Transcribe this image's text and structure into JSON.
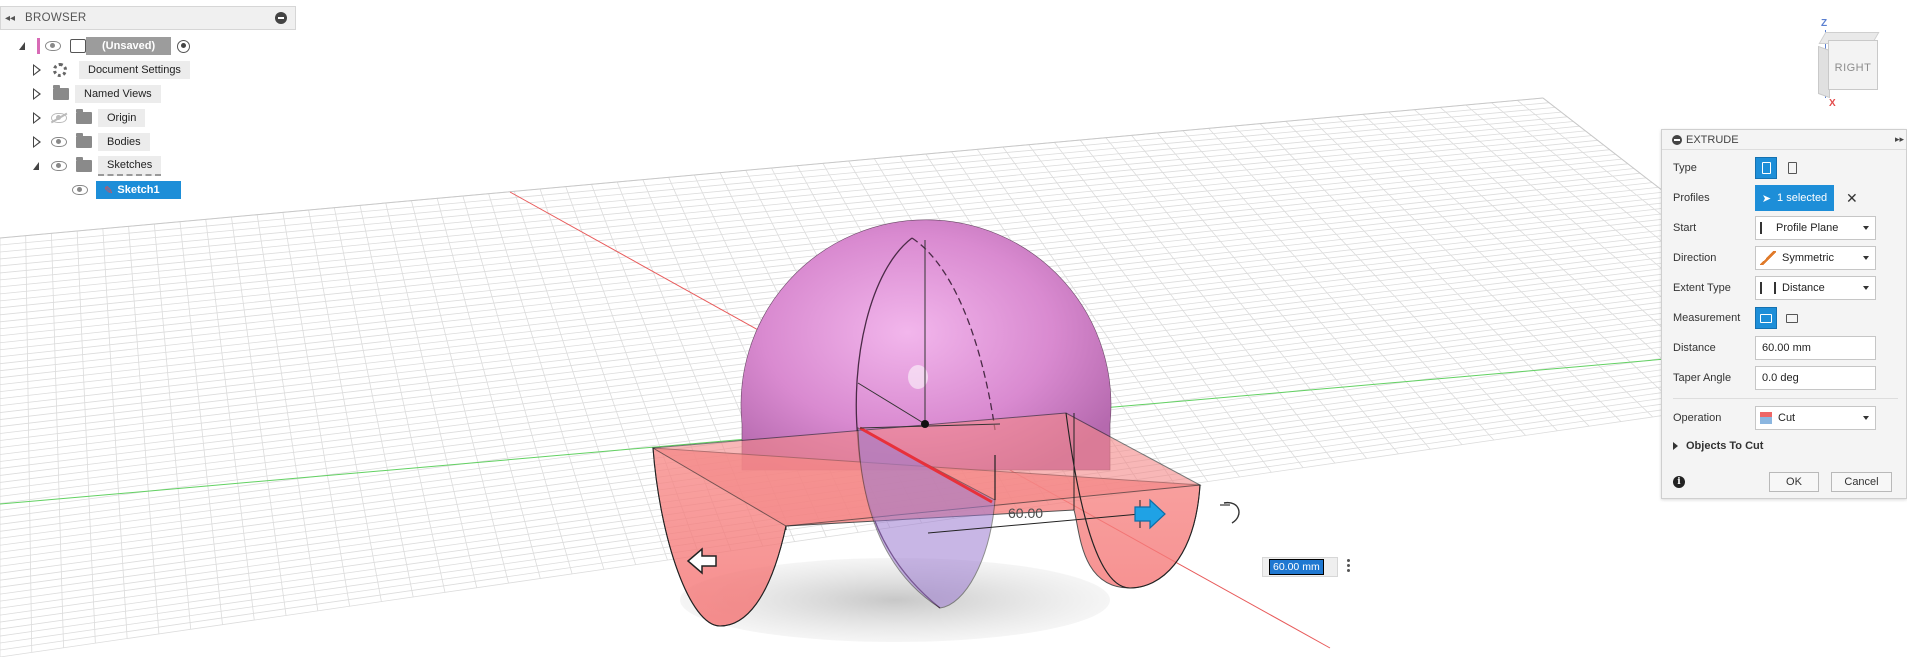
{
  "browser": {
    "title": "BROWSER",
    "root_label": "(Unsaved)",
    "items": [
      {
        "label": "Document Settings"
      },
      {
        "label": "Named Views"
      },
      {
        "label": "Origin"
      },
      {
        "label": "Bodies"
      },
      {
        "label": "Sketches"
      }
    ],
    "sketch_label": "Sketch1"
  },
  "extrude": {
    "title": "EXTRUDE",
    "type_label": "Type",
    "profiles_label": "Profiles",
    "profiles_value": "1 selected",
    "start_label": "Start",
    "start_value": "Profile Plane",
    "direction_label": "Direction",
    "direction_value": "Symmetric",
    "extent_label": "Extent Type",
    "extent_value": "Distance",
    "measurement_label": "Measurement",
    "distance_label": "Distance",
    "distance_value": "60.00 mm",
    "taper_label": "Taper Angle",
    "taper_value": "0.0 deg",
    "operation_label": "Operation",
    "operation_value": "Cut",
    "objects_label": "Objects To Cut",
    "ok_label": "OK",
    "cancel_label": "Cancel"
  },
  "viewcube": {
    "face_label": "RIGHT",
    "axis_z": "Z",
    "axis_x": "X"
  },
  "canvas": {
    "dimension_label": "60.00",
    "distance_input": "60.00 mm"
  },
  "colors": {
    "accent": "#1d8ed8",
    "cut_body": "#f47a7a",
    "sphere": "#d77ccc",
    "x_axis": "#e34a4a",
    "y_axis": "#4cc94c"
  }
}
